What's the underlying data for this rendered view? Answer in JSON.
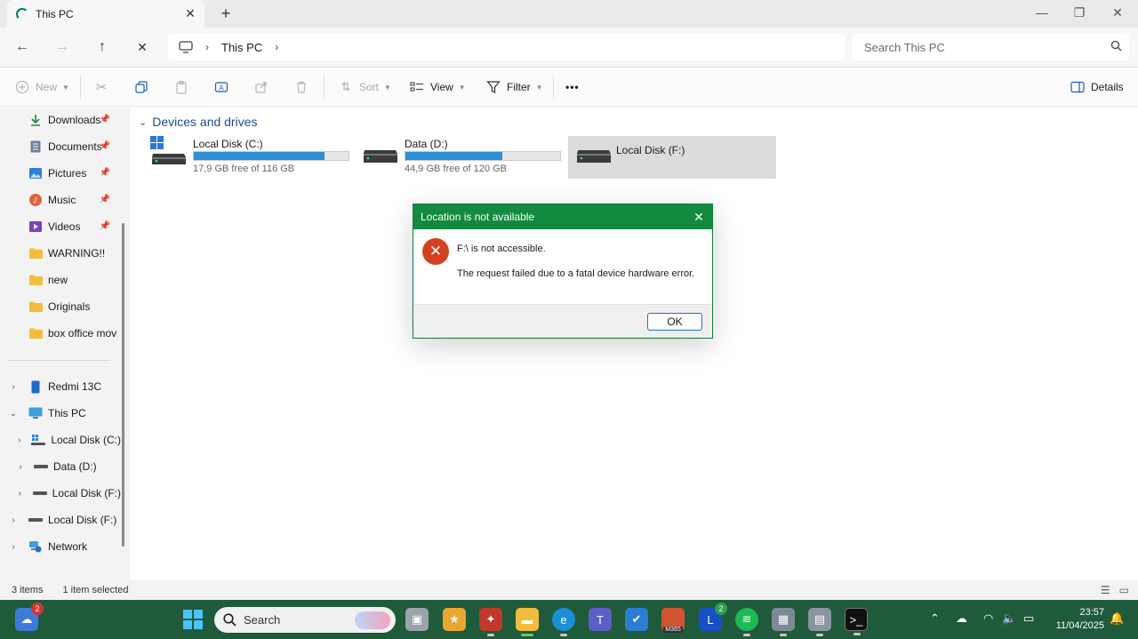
{
  "window": {
    "tab_title": "This PC",
    "new_tab": "+"
  },
  "nav": {
    "breadcrumb": [
      "This PC"
    ],
    "search_placeholder": "Search This PC"
  },
  "toolbar": {
    "new_label": "New",
    "sort_label": "Sort",
    "view_label": "View",
    "filter_label": "Filter",
    "more_label": "•••",
    "details_label": "Details"
  },
  "sidebar": {
    "quick_access": [
      {
        "label": "Downloads",
        "icon": "download-icon"
      },
      {
        "label": "Documents",
        "icon": "documents-icon"
      },
      {
        "label": "Pictures",
        "icon": "pictures-icon"
      },
      {
        "label": "Music",
        "icon": "music-icon"
      },
      {
        "label": "Videos",
        "icon": "videos-icon"
      },
      {
        "label": "WARNING!!",
        "icon": "folder-icon"
      },
      {
        "label": "new",
        "icon": "folder-icon"
      },
      {
        "label": "Originals",
        "icon": "folder-icon"
      },
      {
        "label": "box office movie",
        "icon": "folder-icon"
      }
    ],
    "tree": [
      {
        "label": "Redmi 13C",
        "icon": "phone-icon"
      },
      {
        "label": "This PC",
        "icon": "pc-icon"
      },
      {
        "label": "Local Disk (C:)",
        "icon": "windows-drive-icon"
      },
      {
        "label": "Data (D:)",
        "icon": "drive-icon"
      },
      {
        "label": "Local Disk (F:)",
        "icon": "drive-icon"
      },
      {
        "label": "Local Disk (F:)",
        "icon": "drive-icon"
      },
      {
        "label": "Network",
        "icon": "network-icon"
      }
    ]
  },
  "main": {
    "section_title": "Devices and drives",
    "drives": [
      {
        "name": "Local Disk (C:)",
        "free": "17,9 GB free of 116 GB",
        "used_fraction": 0.846,
        "selected": false
      },
      {
        "name": "Data (D:)",
        "free": "44,9 GB free of 120 GB",
        "used_fraction": 0.626,
        "selected": false
      },
      {
        "name": "Local Disk (F:)",
        "free": "",
        "used_fraction": null,
        "selected": true
      }
    ]
  },
  "dialog": {
    "title": "Location is not available",
    "message_line1": "F:\\ is not accessible.",
    "message_line2": "The request failed due to a fatal device hardware error.",
    "ok_label": "OK"
  },
  "status": {
    "item_count": "3 items",
    "selection": "1 item selected"
  },
  "taskbar": {
    "search_label": "Search",
    "widgets_badge": "2",
    "teams_badge": "2",
    "m365_label": "M365",
    "time": "23:57",
    "date": "11/04/2025"
  },
  "colors": {
    "accent_green": "#138a3f",
    "taskbar": "#1f5a3a",
    "drive_bar": "#2d8fd8",
    "error_red": "#d4401f"
  }
}
